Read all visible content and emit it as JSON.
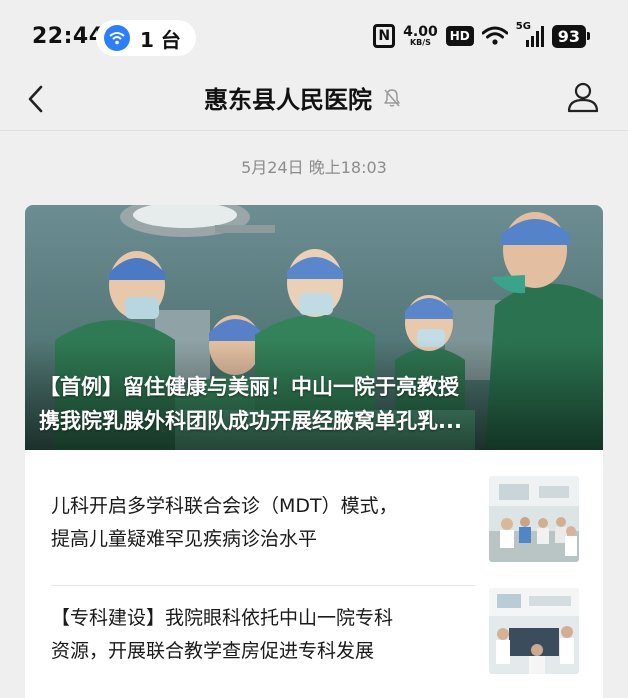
{
  "status_bar": {
    "time": "22:44",
    "device_count": "1 台",
    "net_speed": "4.00",
    "net_speed_unit": "KB/S",
    "hd_label": "HD",
    "network_label": "5G",
    "battery": "93"
  },
  "header": {
    "title": "惠东县人民医院"
  },
  "message": {
    "timestamp": "5月24日 晚上18:03",
    "headline_line1": "【首例】留住健康与美丽！中山一院于亮教授",
    "headline_line2": "携我院乳腺外科团队成功开展经腋窝单孔乳...",
    "articles": [
      {
        "line1": "儿科开启多学科联合会诊（MDT）模式，",
        "line2": "提高儿童疑难罕见疾病诊治水平"
      },
      {
        "line1": "【专科建设】我院眼科依托中山一院专科",
        "line2": "资源，开展联合教学查房促进专科发展"
      }
    ]
  },
  "colors": {
    "accent": "#2d7ff9",
    "background": "#efefef",
    "card": "#ffffff",
    "timestamp": "#8c8c8c"
  }
}
